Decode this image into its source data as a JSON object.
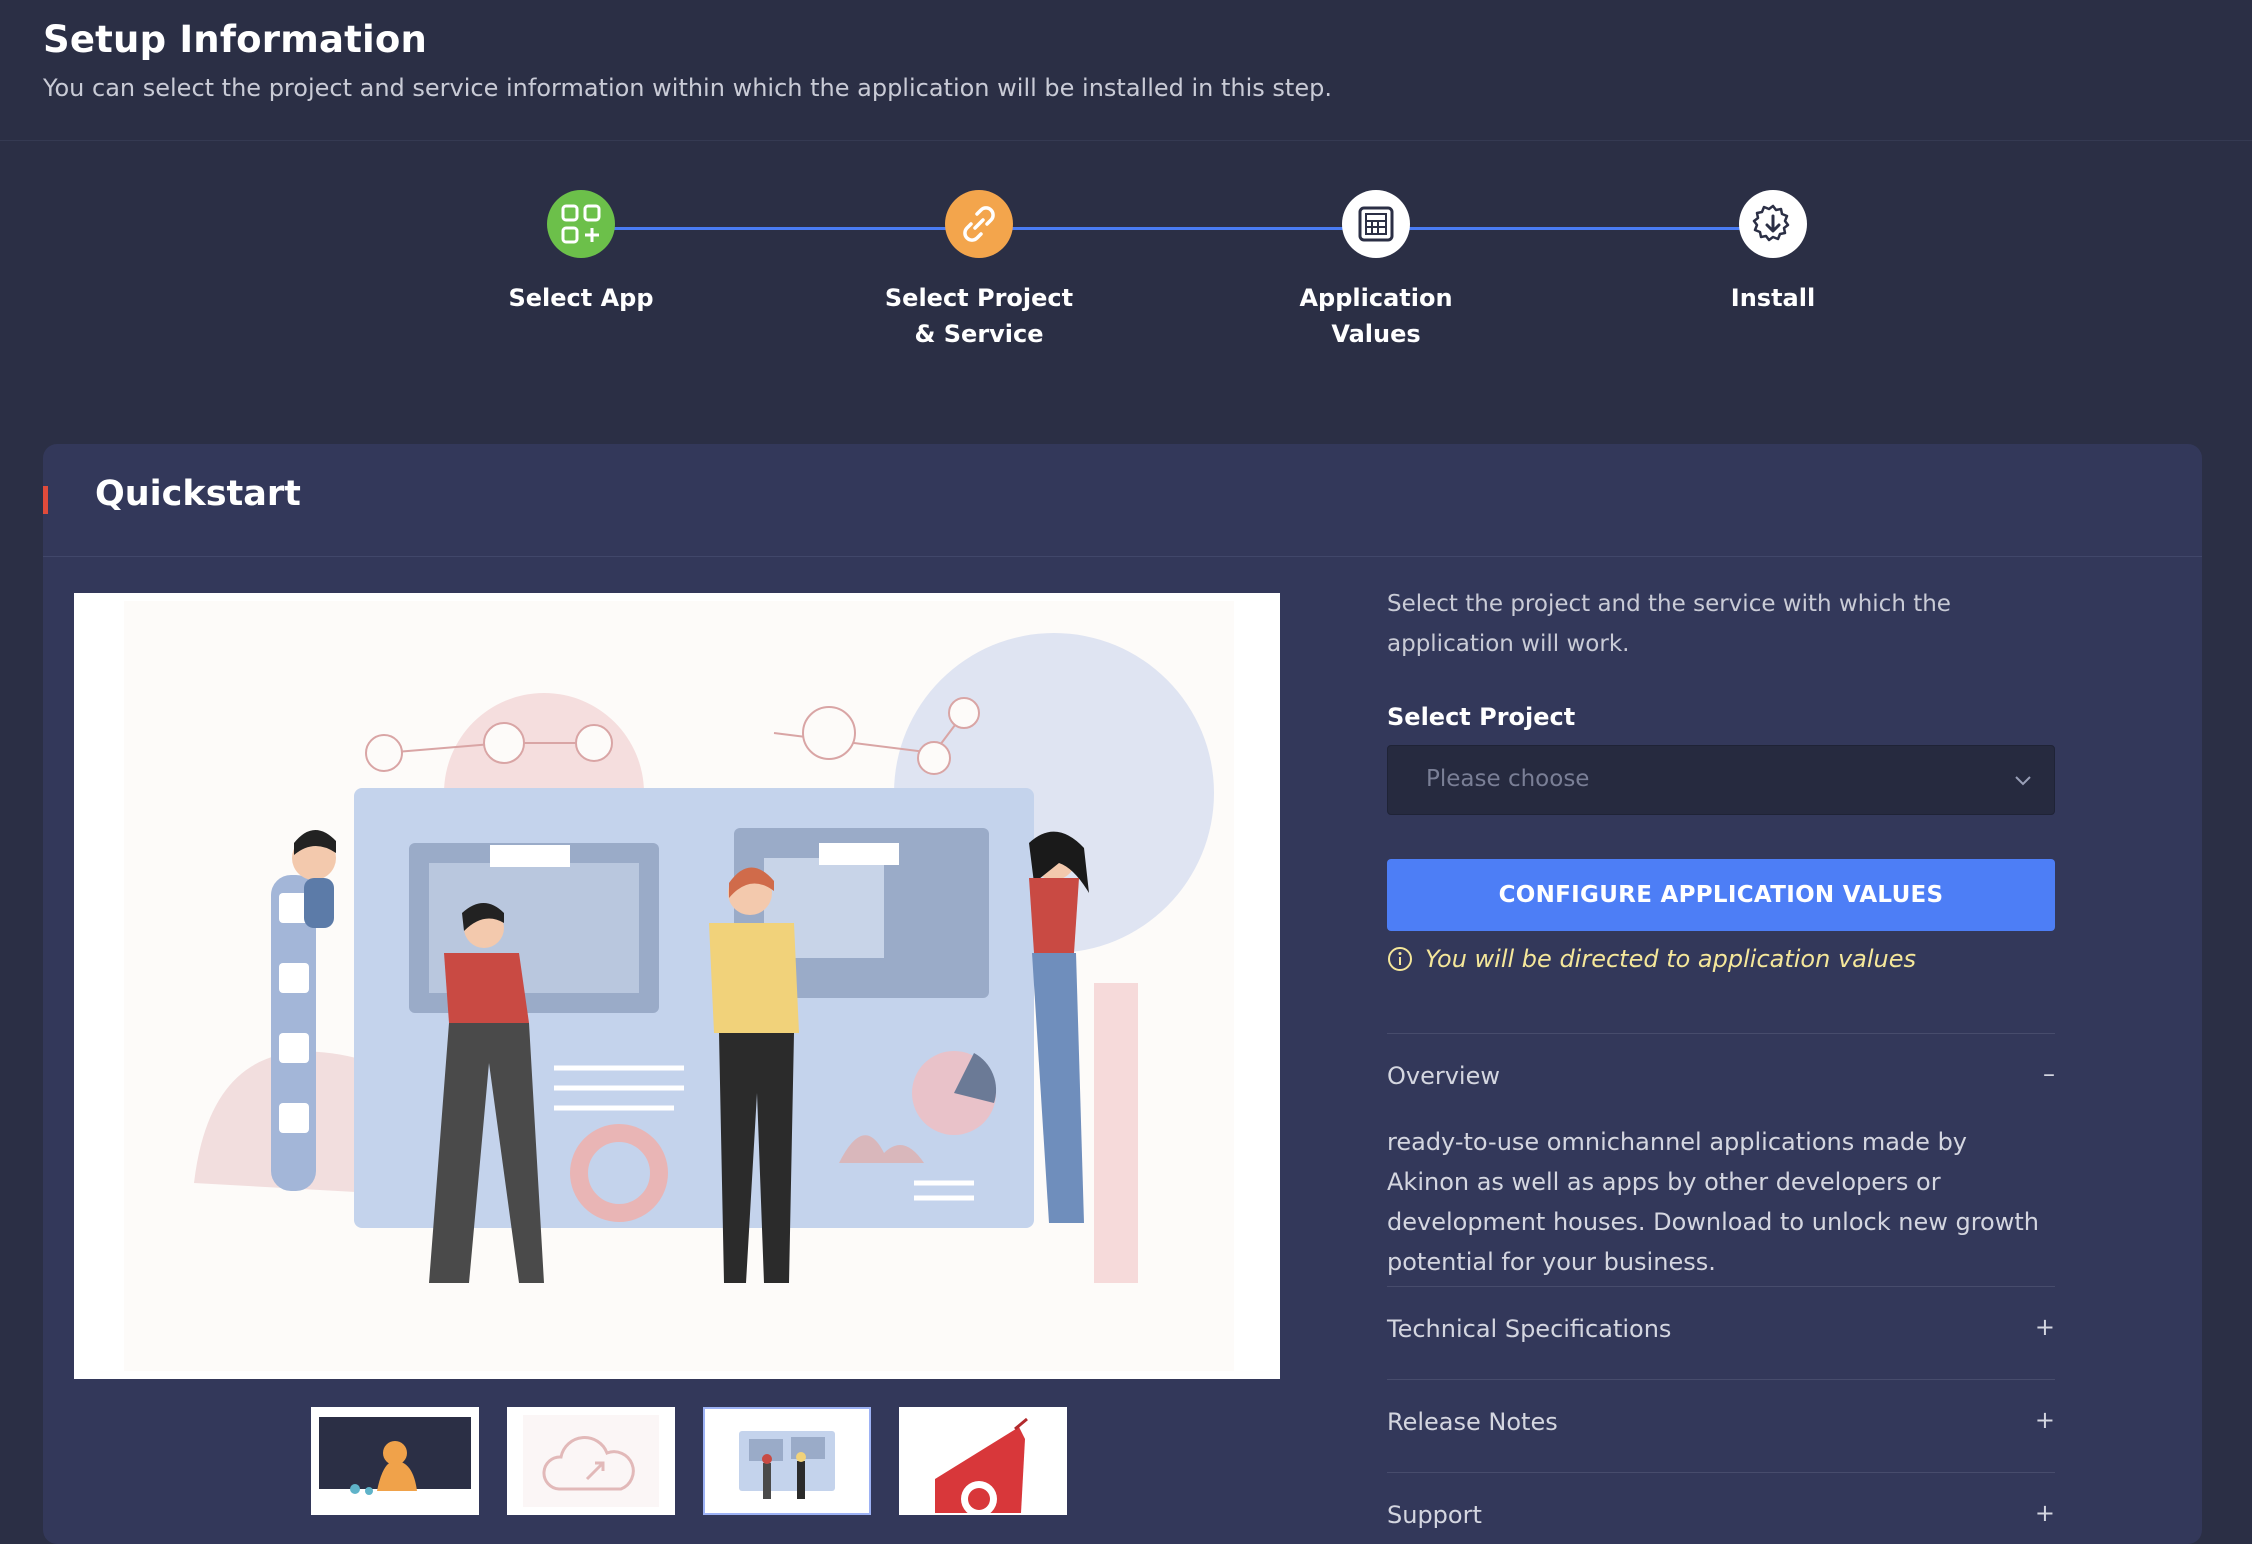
{
  "page": {
    "title": "Setup Information",
    "subtitle": "You can select the project and service information within which the application will be installed in this step."
  },
  "stepper": {
    "steps": [
      {
        "label": "Select App",
        "icon": "apps-add-icon",
        "color": "#6cc04a"
      },
      {
        "label": "Select Project\n& Service",
        "icon": "link-icon",
        "color": "#f3a54c"
      },
      {
        "label": "Application\nValues",
        "icon": "server-rack-icon",
        "color": "#ffffff"
      },
      {
        "label": "Install",
        "icon": "gear-download-icon",
        "color": "#ffffff"
      }
    ],
    "line_color": "#4a7cf3"
  },
  "card": {
    "title": "Quickstart",
    "accent_color": "#e04b3b"
  },
  "gallery": {
    "thumbnails": [
      {
        "name": "cat-illustration",
        "active": false
      },
      {
        "name": "cloud-illustration",
        "active": false
      },
      {
        "name": "team-dashboard-illustration",
        "active": true
      },
      {
        "name": "red-logo-illustration",
        "active": false
      }
    ]
  },
  "setup_form": {
    "intro": "Select the project and the service with which the application will work.",
    "project_label": "Select Project",
    "project_placeholder": "Please choose",
    "configure_button": "CONFIGURE APPLICATION VALUES",
    "hint": "You will be directed to application values",
    "button_color": "#4d7ef6",
    "hint_color": "#f5e79a"
  },
  "accordion": {
    "overview": {
      "title": "Overview",
      "toggle": "–",
      "body": "ready-to-use omnichannel applications made by Akinon as well as apps by other developers or development houses. Download to unlock new growth potential for your business."
    },
    "items": [
      {
        "title": "Technical Specifications",
        "toggle": "+"
      },
      {
        "title": "Release Notes",
        "toggle": "+"
      },
      {
        "title": "Support",
        "toggle": "+"
      }
    ]
  }
}
